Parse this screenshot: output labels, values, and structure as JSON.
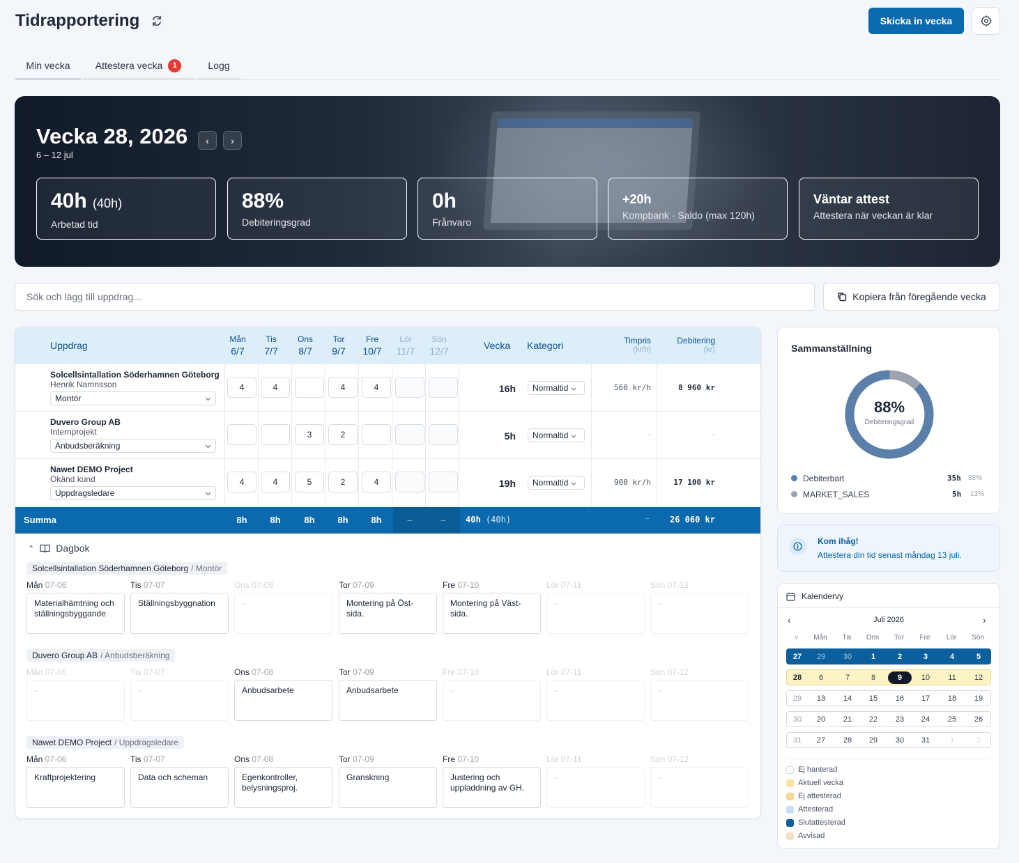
{
  "header": {
    "title": "Tidrapportering",
    "submit_label": "Skicka in vecka"
  },
  "tabs": [
    {
      "label": "Min vecka",
      "active": true
    },
    {
      "label": "Attestera vecka",
      "badge": "1"
    },
    {
      "label": "Logg"
    }
  ],
  "hero": {
    "week_title": "Vecka 28, 2026",
    "date_range": "6 – 12 jul",
    "stats": [
      {
        "value": "40h",
        "extra": "(40h)",
        "label": "Arbetad tid"
      },
      {
        "value": "88%",
        "label": "Debiteringsgrad"
      },
      {
        "value": "0h",
        "label": "Frånvaro"
      },
      {
        "value": "+20h",
        "label": "Kompbank · Saldo (max 120h)"
      },
      {
        "value": "Väntar attest",
        "label": "Attestera när veckan är klar"
      }
    ]
  },
  "search": {
    "placeholder": "Sök och lägg till uppdrag..."
  },
  "copy_label": "Kopiera från föregående vecka",
  "table": {
    "headers": {
      "assignment": "Uppdrag",
      "week": "Vecka",
      "category": "Kategori",
      "rate": "Timpris",
      "rate_unit": "(kr/h)",
      "billing": "Debitering",
      "billing_unit": "(kr)"
    },
    "days": [
      {
        "name": "Mån",
        "date": "6/7"
      },
      {
        "name": "Tis",
        "date": "7/7"
      },
      {
        "name": "Ons",
        "date": "8/7"
      },
      {
        "name": "Tor",
        "date": "9/7"
      },
      {
        "name": "Fre",
        "date": "10/7"
      },
      {
        "name": "Lör",
        "date": "11/7"
      },
      {
        "name": "Sön",
        "date": "12/7"
      }
    ],
    "rows": [
      {
        "name": "Solcellsintallation Söderhamnen Göteborg",
        "client": "Henrik Namnsson",
        "role": "Montör",
        "hours": [
          "4",
          "4",
          "",
          "4",
          "4",
          "",
          ""
        ],
        "week": "16h",
        "category": "Normaltid",
        "rate": "560 kr/h",
        "billing": "8 960 kr"
      },
      {
        "name": "Duvero Group AB",
        "client": "Internprojekt",
        "role": "Anbudsberäkning",
        "hours": [
          "",
          "",
          "3",
          "2",
          "",
          "",
          ""
        ],
        "week": "5h",
        "category": "Normaltid",
        "rate": "–",
        "billing": "–"
      },
      {
        "name": "Nawet DEMO Project",
        "client": "Okänd kund",
        "role": "Uppdragsledare",
        "hours": [
          "4",
          "4",
          "5",
          "2",
          "4",
          "",
          ""
        ],
        "week": "19h",
        "category": "Normaltid",
        "rate": "900 kr/h",
        "billing": "17 100 kr"
      }
    ],
    "sum": {
      "label": "Summa",
      "days": [
        "8h",
        "8h",
        "8h",
        "8h",
        "8h",
        "–",
        "–"
      ],
      "week": "40h",
      "week_extra": "(40h)",
      "rate": "–",
      "billing": "26 060 kr"
    }
  },
  "diary": {
    "title": "Dagbok",
    "groups": [
      {
        "project": "Solcellsintallation Söderhamnen Göteborg",
        "role": "/ Montör",
        "days": [
          {
            "day": "Mån",
            "date": "07-06",
            "text": "Materialhämtning och ställningsbyggande"
          },
          {
            "day": "Tis",
            "date": "07-07",
            "text": "Ställningsbyggnation"
          },
          {
            "day": "Ons",
            "date": "07-08",
            "text": "–",
            "dim": true
          },
          {
            "day": "Tor",
            "date": "07-09",
            "text": "Montering på Öst-sida."
          },
          {
            "day": "Fre",
            "date": "07-10",
            "text": "Montering på Väst-sida."
          },
          {
            "day": "Lör",
            "date": "07-11",
            "text": "–",
            "dim": true
          },
          {
            "day": "Sön",
            "date": "07-12",
            "text": "–",
            "dim": true
          }
        ]
      },
      {
        "project": "Duvero Group AB",
        "role": "/ Anbudsberäkning",
        "days": [
          {
            "day": "Mån",
            "date": "07-06",
            "text": "–",
            "dim": true
          },
          {
            "day": "Tis",
            "date": "07-07",
            "text": "–",
            "dim": true
          },
          {
            "day": "Ons",
            "date": "07-08",
            "text": "Anbudsarbete"
          },
          {
            "day": "Tor",
            "date": "07-09",
            "text": "Anbudsarbete"
          },
          {
            "day": "Fre",
            "date": "07-10",
            "text": "–",
            "dim": true
          },
          {
            "day": "Lör",
            "date": "07-11",
            "text": "–",
            "dim": true
          },
          {
            "day": "Sön",
            "date": "07-12",
            "text": "–",
            "dim": true
          }
        ]
      },
      {
        "project": "Nawet DEMO Project",
        "role": "/ Uppdragsledare",
        "days": [
          {
            "day": "Mån",
            "date": "07-06",
            "text": "Kraftprojektering"
          },
          {
            "day": "Tis",
            "date": "07-07",
            "text": "Data och scheman"
          },
          {
            "day": "Ons",
            "date": "07-08",
            "text": "Egenkontroller, belysningsproj."
          },
          {
            "day": "Tor",
            "date": "07-09",
            "text": "Granskning"
          },
          {
            "day": "Fre",
            "date": "07-10",
            "text": "Justering och uppladdning av GH."
          },
          {
            "day": "Lör",
            "date": "07-11",
            "text": "–",
            "dim": true
          },
          {
            "day": "Sön",
            "date": "07-12",
            "text": "–",
            "dim": true
          }
        ]
      }
    ]
  },
  "summary": {
    "title": "Sammanställning",
    "percent": "88%",
    "percent_label": "Debiteringsgrad",
    "billable_fraction": 0.875,
    "colors": {
      "billable": "#5a7fa8",
      "market": "#9ca3af"
    },
    "items": [
      {
        "label": "Debiterbart",
        "hours": "35h",
        "pct": "88%"
      },
      {
        "label": "MARKET_SALES",
        "hours": "5h",
        "pct": "13%"
      }
    ]
  },
  "reminder": {
    "title": "Kom ihåg!",
    "text": "Attestera din tid senast måndag 13 juli."
  },
  "calendar": {
    "title": "Kalendervy",
    "month": "Juli 2026",
    "week_col": "v",
    "weekdays": [
      "Mån",
      "Tis",
      "Ons",
      "Tor",
      "Fre",
      "Lör",
      "Sön"
    ],
    "weeks": [
      {
        "w": "27",
        "days": [
          "29",
          "30",
          "1",
          "2",
          "3",
          "4",
          "5"
        ]
      },
      {
        "w": "28",
        "days": [
          "6",
          "7",
          "8",
          "9",
          "10",
          "11",
          "12"
        ]
      },
      {
        "w": "29",
        "days": [
          "13",
          "14",
          "15",
          "16",
          "17",
          "18",
          "19"
        ]
      },
      {
        "w": "30",
        "days": [
          "20",
          "21",
          "22",
          "23",
          "24",
          "25",
          "26"
        ]
      },
      {
        "w": "31",
        "days": [
          "27",
          "28",
          "29",
          "30",
          "31",
          "1",
          "2"
        ]
      }
    ],
    "today": "9",
    "legend": [
      {
        "label": "Ej hanterad",
        "color": "#ffffff"
      },
      {
        "label": "Aktuell vecka",
        "color": "#fbe3a0"
      },
      {
        "label": "Ej attesterad",
        "color": "#f7d796"
      },
      {
        "label": "Attesterad",
        "color": "#c9def0"
      },
      {
        "label": "Slutattesterad",
        "color": "#0b5f9c"
      },
      {
        "label": "Avvisad",
        "color": "#f3e0c8"
      }
    ]
  }
}
